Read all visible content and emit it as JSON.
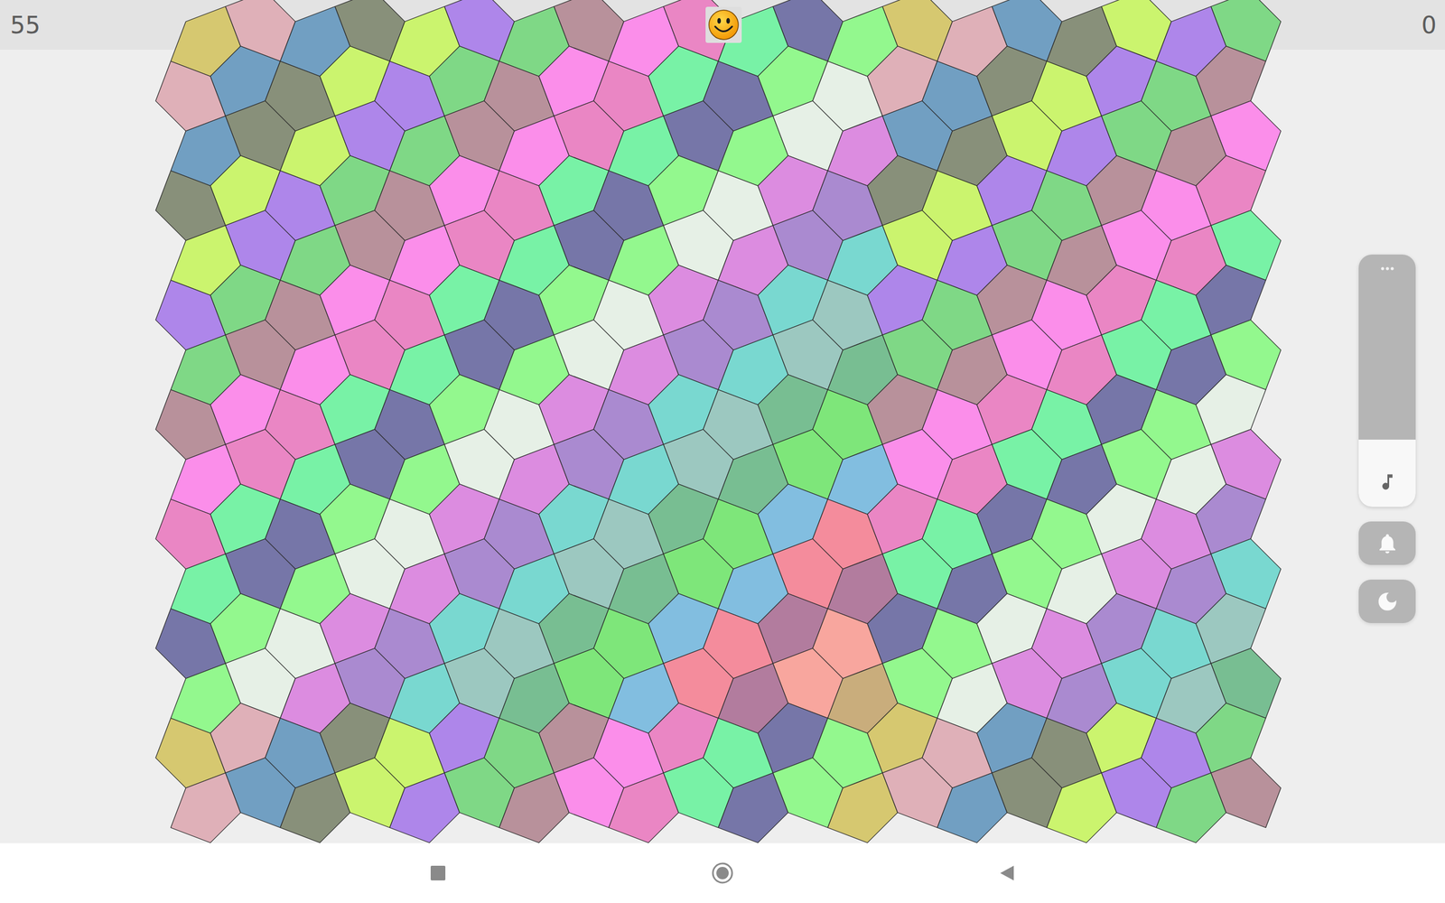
{
  "status_bar": {
    "left_counter": "55",
    "right_counter": "0",
    "face": "happy"
  },
  "board": {
    "palette": {
      "a": "#d6c870",
      "b": "#dfb0b8",
      "c": "#719fc2",
      "d": "#88907a",
      "e": "#cbf46e",
      "f": "#ae86ea",
      "g": "#7fd886",
      "h": "#b8919b",
      "i": "#fb8eea",
      "j": "#ea86c4",
      "k": "#78f2a6",
      "l": "#7676a8",
      "m": "#93f88e",
      "n": "#e6f0e6",
      "o": "#dc8ce0",
      "p": "#aa8ad0",
      "q": "#79d8d0",
      "r": "#9cc8c0",
      "s": "#78be92",
      "t": "#7ee67a",
      "u": "#82bee0",
      "v": "#f48c9c",
      "w": "#b27c9e",
      "x": "#f8a69e",
      "y": "#c9ad7c"
    },
    "rows": [
      "abcdefghijklmabcdefg",
      "bcdefghijklmnbcdefgh",
      "cdefghijklmnocdefghi",
      "defghijklmnopdefghij",
      "efghijklmnopqefghijk",
      "fghijklmnopqrfghijkl",
      "ghijklmnopqrsghijklm",
      "hijklmnopqrsthijklmn",
      "ijklmnopqrstuijklmno",
      "jklmnopqrstuvjklmnop",
      "klmnopqrstuvwklmnopq",
      "lmnopqrstuvwxlmnopqr",
      "mnopqrstuvwxymnopqrs",
      "abcdefghijklmabcdefg",
      "bcdefghijklmabcdefgh"
    ]
  },
  "volume_panel": {
    "level": 0.3,
    "buttons": [
      {
        "kind": "ringer"
      },
      {
        "kind": "dark-mode"
      }
    ]
  },
  "nav_bar": {
    "buttons": [
      {
        "kind": "recents"
      },
      {
        "kind": "home"
      },
      {
        "kind": "back"
      }
    ]
  }
}
